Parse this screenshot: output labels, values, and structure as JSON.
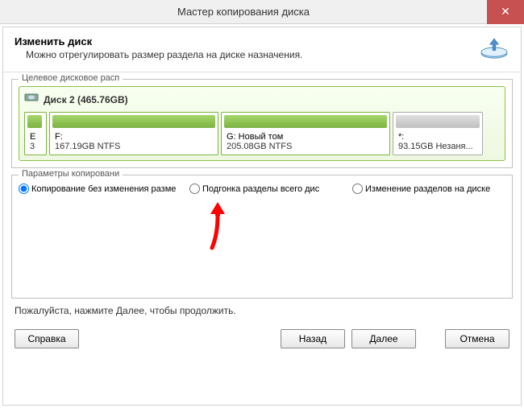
{
  "window": {
    "title": "Мастер копирования диска"
  },
  "header": {
    "title": "Изменить диск",
    "subtitle": "Можно отрегулировать размер раздела на диске назначения."
  },
  "target_group": {
    "legend": "Целевое дисковое расп",
    "disk_label": "Диск 2 (465.76GB)",
    "partitions": [
      {
        "label": "E",
        "size": "3"
      },
      {
        "label": "F:",
        "size": "167.19GB NTFS"
      },
      {
        "label": "G: Новый том",
        "size": "205.08GB NTFS"
      },
      {
        "label": "*:",
        "size": "93.15GB Незаня..."
      }
    ]
  },
  "copy_options": {
    "legend": "Параметры копировани",
    "items": [
      {
        "label": "Копирование без изменения разме"
      },
      {
        "label": "Подгонка разделы всего дис"
      },
      {
        "label": "Изменение разделов на диске"
      }
    ],
    "selected": 0
  },
  "hint": "Пожалуйста, нажмите Далее, чтобы продолжить.",
  "buttons": {
    "help": "Справка",
    "back": "Назад",
    "next": "Далее",
    "cancel": "Отмена"
  }
}
